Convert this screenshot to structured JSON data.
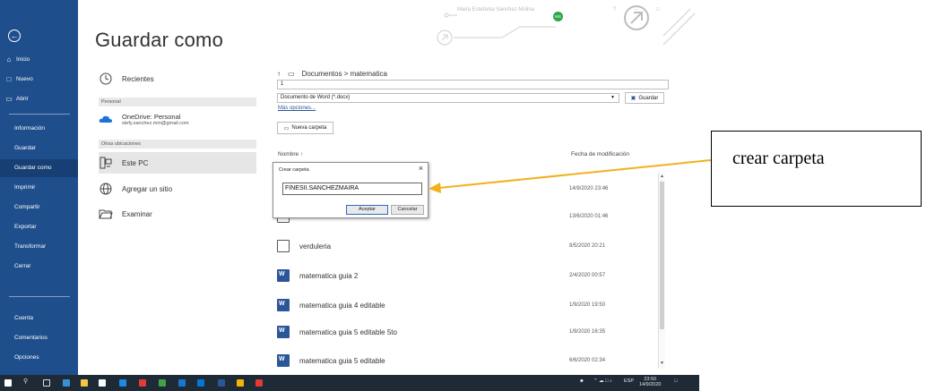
{
  "sidebar": {
    "top_items": [
      {
        "icon": "home-icon",
        "label": "Inicio"
      },
      {
        "icon": "new-document-icon",
        "label": "Nuevo"
      },
      {
        "icon": "open-folder-icon",
        "label": "Abrir"
      }
    ],
    "items": [
      {
        "label": "Información"
      },
      {
        "label": "Guardar"
      },
      {
        "label": "Guardar como",
        "active": true
      },
      {
        "label": "Imprimir"
      },
      {
        "label": "Compartir"
      },
      {
        "label": "Exportar"
      },
      {
        "label": "Transformar"
      },
      {
        "label": "Cerrar"
      }
    ],
    "bottom_items": [
      {
        "label": "Cuenta"
      },
      {
        "label": "Comentarios"
      },
      {
        "label": "Opciones"
      }
    ]
  },
  "page": {
    "title": "Guardar como"
  },
  "places": {
    "recent": "Recientes",
    "personal_header": "Personal",
    "onedrive_name": "OneDrive: Personal",
    "onedrive_email": "stefy.sanchez.mm@gmail.com",
    "other_header": "Otras ubicaciones",
    "this_pc": "Este PC",
    "add_site": "Agregar un sitio",
    "browse": "Examinar"
  },
  "save": {
    "path": "Documentos > matematica",
    "filename": "1",
    "filetype": "Documento de Word (*.docx)",
    "save_button": "Guardar",
    "more_options": "Más opciones...",
    "new_folder": "Nueva carpeta"
  },
  "list": {
    "col_name": "Nombre",
    "col_date": "Fecha de modificación",
    "rows": [
      {
        "name": "",
        "date": "14/9/2020 23:46",
        "type": "folder"
      },
      {
        "name": "",
        "date": "13/6/2020 01:46",
        "type": "folder"
      },
      {
        "name": "verduleria",
        "date": "8/5/2020 20:21",
        "type": "folder"
      },
      {
        "name": "matematica guia 2",
        "date": "2/4/2020 00:57",
        "type": "word"
      },
      {
        "name": "matematica guia 4 editable",
        "date": "1/9/2020 19:50",
        "type": "word"
      },
      {
        "name": "matematica guia 5 editable 5to",
        "date": "1/9/2020 16:35",
        "type": "word"
      },
      {
        "name": "matematica guia 5 editable",
        "date": "6/6/2020 02:34",
        "type": "word"
      }
    ]
  },
  "dialog": {
    "title": "Crear carpeta",
    "value": "FINESII.SANCHEZMAIRA",
    "ok": "Aceptar",
    "cancel": "Cancelar"
  },
  "titlebar": {
    "user_name": "Maira Estefania Sanchez Molina",
    "avatar_initials": "MS",
    "help": "?"
  },
  "taskbar": {
    "language": "ESP",
    "time": "23:50",
    "date": "14/9/2020"
  },
  "callout": {
    "text": "crear carpeta"
  },
  "colors": {
    "sidebar": "#1e4e8c",
    "sidebar_active": "#173f74",
    "taskbar": "#1f2a37",
    "arrow": "#f2b01e",
    "word": "#2b579a"
  }
}
